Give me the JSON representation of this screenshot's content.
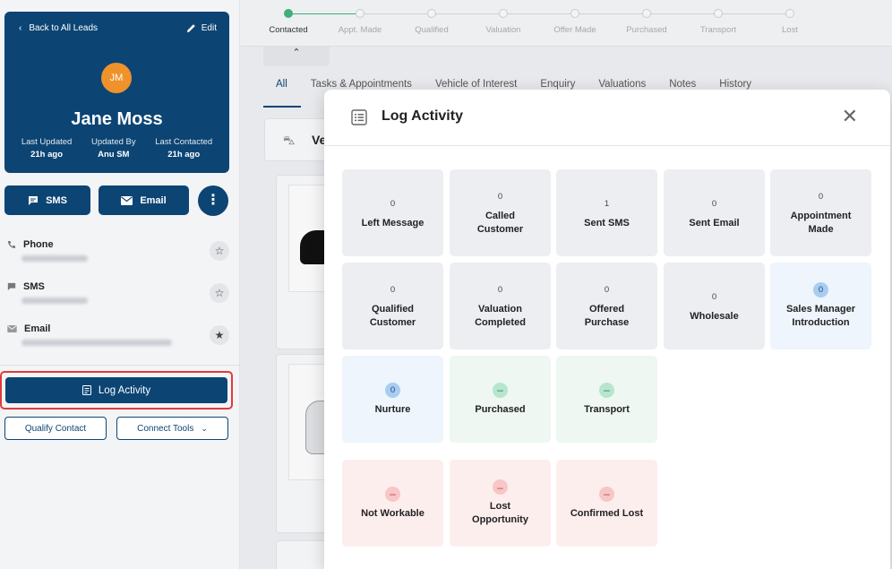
{
  "lead": {
    "back_label": "Back to All Leads",
    "edit_label": "Edit",
    "initials": "JM",
    "name": "Jane Moss",
    "meta": [
      {
        "label": "Last Updated",
        "value": "21h ago"
      },
      {
        "label": "Updated By",
        "value": "Anu SM"
      },
      {
        "label": "Last Contacted",
        "value": "21h ago"
      }
    ]
  },
  "actions": {
    "sms": "SMS",
    "email": "Email"
  },
  "contacts": {
    "phone": "Phone",
    "sms": "SMS",
    "email": "Email"
  },
  "sidebar_buttons": {
    "log_activity": "Log Activity",
    "qualify": "Qualify Contact",
    "connect": "Connect Tools"
  },
  "stepper": [
    "Contacted",
    "Appt. Made",
    "Qualified",
    "Valuation",
    "Offer Made",
    "Purchased",
    "Transport",
    "Lost"
  ],
  "tabs": [
    "All",
    "Tasks & Appointments",
    "Vehicle of Interest",
    "Enquiry",
    "Valuations",
    "Notes",
    "History"
  ],
  "background": {
    "section_prefix": "Ve"
  },
  "modal": {
    "title": "Log Activity",
    "close": "✕",
    "tiles": [
      {
        "count": "0",
        "name": "Left Message"
      },
      {
        "count": "0",
        "name": "Called Customer"
      },
      {
        "count": "1",
        "name": "Sent SMS"
      },
      {
        "count": "0",
        "name": "Sent Email"
      },
      {
        "count": "0",
        "name": "Appointment Made"
      },
      {
        "count": "0",
        "name": "Qualified Customer"
      },
      {
        "count": "0",
        "name": "Valuation Completed"
      },
      {
        "count": "0",
        "name": "Offered Purchase"
      },
      {
        "count": "0",
        "name": "Wholesale"
      },
      {
        "count": "0",
        "name": "Sales Manager Introduction"
      },
      {
        "count": "0",
        "name": "Nurture"
      },
      {
        "count": "–",
        "name": "Purchased"
      },
      {
        "count": "–",
        "name": "Transport"
      },
      {
        "count": "–",
        "name": "Not Workable"
      },
      {
        "count": "–",
        "name": "Lost Opportunity"
      },
      {
        "count": "–",
        "name": "Confirmed Lost"
      }
    ]
  },
  "colors": {
    "brand_navy": "#0c4574",
    "accent_orange": "#f0922b",
    "step_done": "#3fb07a",
    "highlight_red": "#e23a3a"
  }
}
